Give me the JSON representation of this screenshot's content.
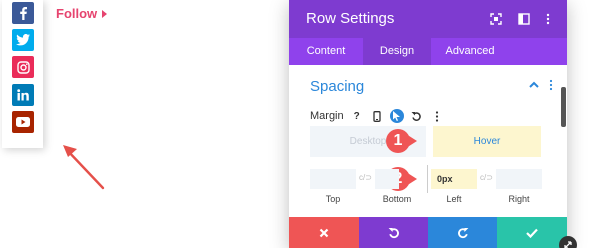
{
  "social": {
    "follow_label": "Follow",
    "items": [
      {
        "name": "facebook",
        "glyph": "f",
        "color": "#3b5998"
      },
      {
        "name": "twitter",
        "glyph": "t",
        "color": "#00aced"
      },
      {
        "name": "instagram",
        "glyph": "ig",
        "color": "#ea2c59"
      },
      {
        "name": "linkedin",
        "glyph": "in",
        "color": "#007bb6"
      },
      {
        "name": "youtube",
        "glyph": "yt",
        "color": "#a82400"
      }
    ],
    "accent_color": "#e6446f"
  },
  "panel": {
    "title": "Row Settings",
    "header_icons": [
      "screenshot-icon",
      "sidebar-toggle-icon",
      "more-vertical-icon"
    ],
    "tabs": [
      {
        "label": "Content",
        "active": false
      },
      {
        "label": "Design",
        "active": true
      },
      {
        "label": "Advanced",
        "active": false
      }
    ],
    "section": {
      "title": "Spacing",
      "margin_label": "Margin",
      "device_tabs": {
        "desktop": "Desktop",
        "hover": "Hover"
      },
      "badges": [
        "1",
        "2"
      ],
      "fields": [
        {
          "label": "Top",
          "value": ""
        },
        {
          "label": "Bottom",
          "value": ""
        },
        {
          "label": "Left",
          "value": "0px"
        },
        {
          "label": "Right",
          "value": ""
        }
      ],
      "link_glyph": "c/⊃"
    },
    "colors": {
      "header": "#7e3bd0",
      "tabs": "#8f42ec",
      "accent": "#2b87da",
      "cancel": "#ef5555",
      "undo": "#7e3bd0",
      "redo": "#2b87da",
      "save": "#29c4a9",
      "badge": "#ef5555"
    }
  }
}
